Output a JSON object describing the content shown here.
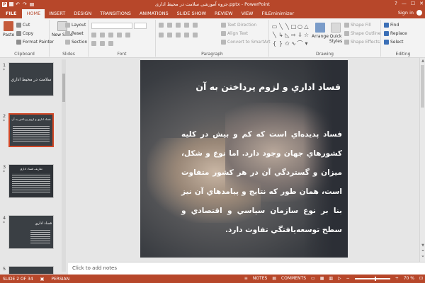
{
  "window": {
    "title": "جزوه آموزشی سلامت در محیط اداری.pptx - PowerPoint",
    "controls": {
      "help": "?",
      "minimize": "—",
      "maximize": "☐",
      "close": "✕"
    }
  },
  "tabs": [
    {
      "label": "FILE"
    },
    {
      "label": "HOME"
    },
    {
      "label": "INSERT"
    },
    {
      "label": "DESIGN"
    },
    {
      "label": "TRANSITIONS"
    },
    {
      "label": "ANIMATIONS"
    },
    {
      "label": "SLIDE SHOW"
    },
    {
      "label": "REVIEW"
    },
    {
      "label": "VIEW"
    },
    {
      "label": "FILEminimizer"
    }
  ],
  "account": {
    "sign_in": "Sign in"
  },
  "ribbon": {
    "clipboard": {
      "label": "Clipboard",
      "paste": "Paste",
      "cut": "Cut",
      "copy": "Copy",
      "format_painter": "Format Painter"
    },
    "slides": {
      "label": "Slides",
      "new_slide": "New Slide",
      "layout": "Layout",
      "reset": "Reset",
      "section": "Section"
    },
    "font": {
      "label": "Font"
    },
    "paragraph": {
      "label": "Paragraph",
      "text_direction": "Text Direction",
      "align_text": "Align Text",
      "convert_smartart": "Convert to SmartArt"
    },
    "drawing": {
      "label": "Drawing",
      "arrange": "Arrange",
      "quick_styles": "Quick Styles",
      "shape_fill": "Shape Fill",
      "shape_outline": "Shape Outline",
      "shape_effects": "Shape Effects"
    },
    "editing": {
      "label": "Editing",
      "find": "Find",
      "replace": "Replace",
      "select": "Select"
    }
  },
  "thumbnails": [
    {
      "num": "1",
      "star": "*",
      "title": "سلامت در محيط اداري"
    },
    {
      "num": "2",
      "star": "*",
      "title": "فساد اداري و لزوم پرداختن به آن"
    },
    {
      "num": "3",
      "star": "*",
      "title": "تعاریف فساد اداري"
    },
    {
      "num": "4",
      "star": "*",
      "title": "فساد اداري"
    },
    {
      "num": "5",
      "star": "",
      "title": ""
    }
  ],
  "slide": {
    "title": "فساد اداري و لزوم پرداختن به آن",
    "body": "فساد پديده‌اي است كه كم و بيش در كليه كشورهاي جهان وجود دارد. اما نوع و شكل، ميزان و گستردگي آن در هر كشور متفاوت است، همان طور كه نتايج و پيامدهاي آن نيز بنا بر نوع سازمان سياسي و اقتصادي و سطح توسعه‌يافتگي تفاوت دارد."
  },
  "notes": {
    "placeholder": "Click to add notes"
  },
  "status": {
    "slide_count": "SLIDE 2 OF 34",
    "language": "PERSIAN",
    "notes": "NOTES",
    "comments": "COMMENTS",
    "zoom": "70 %"
  }
}
